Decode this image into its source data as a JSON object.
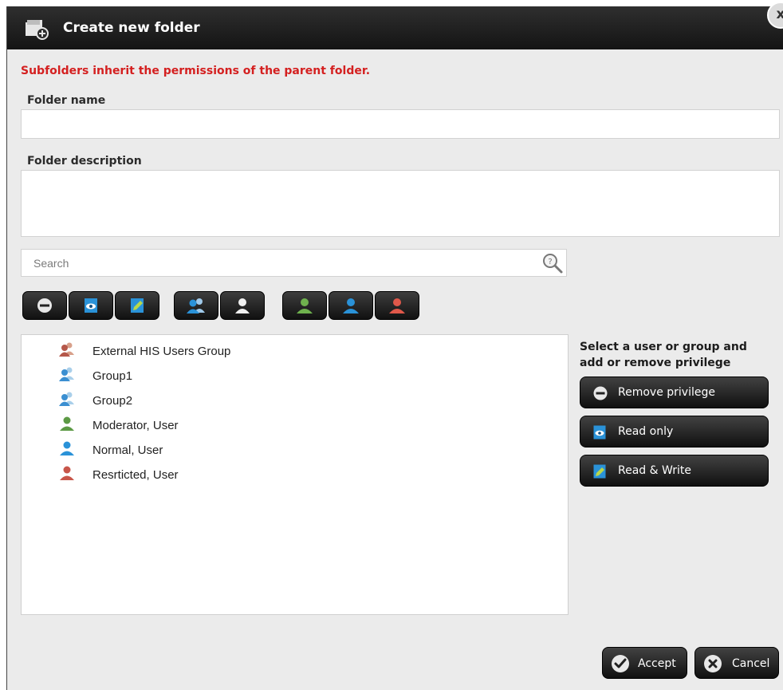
{
  "dialog": {
    "title": "Create new folder",
    "close_label": "x"
  },
  "warning": "Subfolders inherit the permissions of the parent folder.",
  "folder_name": {
    "label": "Folder name",
    "value": ""
  },
  "folder_description": {
    "label": "Folder description",
    "value": ""
  },
  "search": {
    "placeholder": "Search",
    "value": ""
  },
  "toolbar": [
    {
      "name": "remove-privilege-filter",
      "icon": "minus-circle-icon"
    },
    {
      "name": "read-only-filter",
      "icon": "eye-document-icon"
    },
    {
      "name": "read-write-filter",
      "icon": "pencil-document-icon"
    },
    {
      "name": "groups-filter",
      "icon": "group-icon"
    },
    {
      "name": "users-filter",
      "icon": "user-icon"
    },
    {
      "name": "moderator-filter",
      "icon": "moderator-user-icon"
    },
    {
      "name": "normal-filter",
      "icon": "normal-user-icon"
    },
    {
      "name": "restricted-filter",
      "icon": "restricted-user-icon"
    }
  ],
  "principals": [
    {
      "label": "External HIS Users Group",
      "icon": "external-group-icon",
      "color": "#b5574a"
    },
    {
      "label": "Group1",
      "icon": "group-icon",
      "color": "#3b8fd1"
    },
    {
      "label": "Group2",
      "icon": "group-icon",
      "color": "#3b8fd1"
    },
    {
      "label": "Moderator, User",
      "icon": "moderator-user-icon",
      "color": "#5c9a45"
    },
    {
      "label": "Normal, User",
      "icon": "normal-user-icon",
      "color": "#2a92d8"
    },
    {
      "label": "Resrticted, User",
      "icon": "restricted-user-icon",
      "color": "#c8564a"
    }
  ],
  "hint": "Select a user or group and add or remove privilege",
  "actions": {
    "remove": "Remove privilege",
    "read_only": "Read only",
    "read_write": "Read & Write"
  },
  "footer": {
    "accept": "Accept",
    "cancel": "Cancel"
  },
  "colors": {
    "warning": "#d42020",
    "button_dark": "#1a1a1a",
    "accent_blue": "#2a92d8",
    "moderator_green": "#5c9a45",
    "restricted_red": "#c8564a"
  }
}
